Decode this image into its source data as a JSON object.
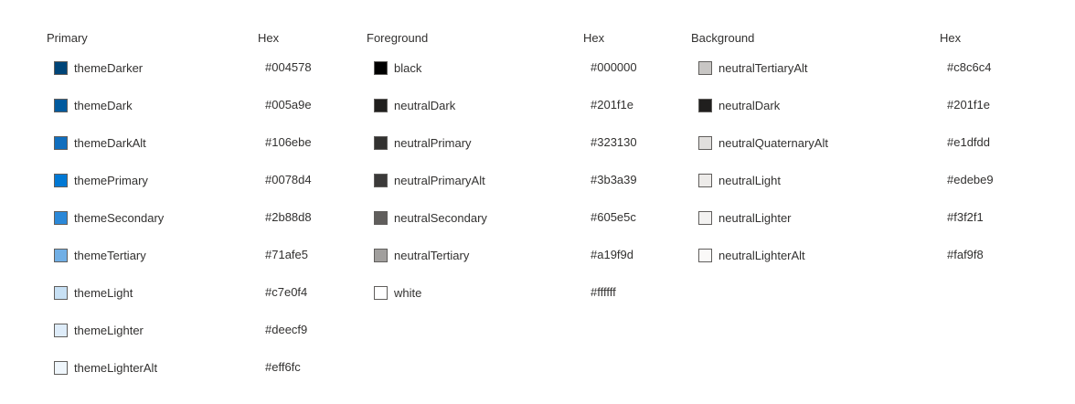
{
  "tables": [
    {
      "name_header": "Primary",
      "hex_header": "Hex",
      "rows": [
        {
          "name": "themeDarker",
          "hex": "#004578"
        },
        {
          "name": "themeDark",
          "hex": "#005a9e"
        },
        {
          "name": "themeDarkAlt",
          "hex": "#106ebe"
        },
        {
          "name": "themePrimary",
          "hex": "#0078d4"
        },
        {
          "name": "themeSecondary",
          "hex": "#2b88d8"
        },
        {
          "name": "themeTertiary",
          "hex": "#71afe5"
        },
        {
          "name": "themeLight",
          "hex": "#c7e0f4"
        },
        {
          "name": "themeLighter",
          "hex": "#deecf9"
        },
        {
          "name": "themeLighterAlt",
          "hex": "#eff6fc"
        }
      ]
    },
    {
      "name_header": "Foreground",
      "hex_header": "Hex",
      "rows": [
        {
          "name": "black",
          "hex": "#000000"
        },
        {
          "name": "neutralDark",
          "hex": "#201f1e"
        },
        {
          "name": "neutralPrimary",
          "hex": "#323130"
        },
        {
          "name": "neutralPrimaryAlt",
          "hex": "#3b3a39"
        },
        {
          "name": "neutralSecondary",
          "hex": "#605e5c"
        },
        {
          "name": "neutralTertiary",
          "hex": "#a19f9d"
        },
        {
          "name": "white",
          "hex": "#ffffff"
        }
      ]
    },
    {
      "name_header": "Background",
      "hex_header": "Hex",
      "rows": [
        {
          "name": "neutralTertiaryAlt",
          "hex": "#c8c6c4"
        },
        {
          "name": "neutralDark",
          "hex": "#201f1e"
        },
        {
          "name": "neutralQuaternaryAlt",
          "hex": "#e1dfdd"
        },
        {
          "name": "neutralLight",
          "hex": "#edebe9"
        },
        {
          "name": "neutralLighter",
          "hex": "#f3f2f1"
        },
        {
          "name": "neutralLighterAlt",
          "hex": "#faf9f8"
        }
      ]
    }
  ]
}
